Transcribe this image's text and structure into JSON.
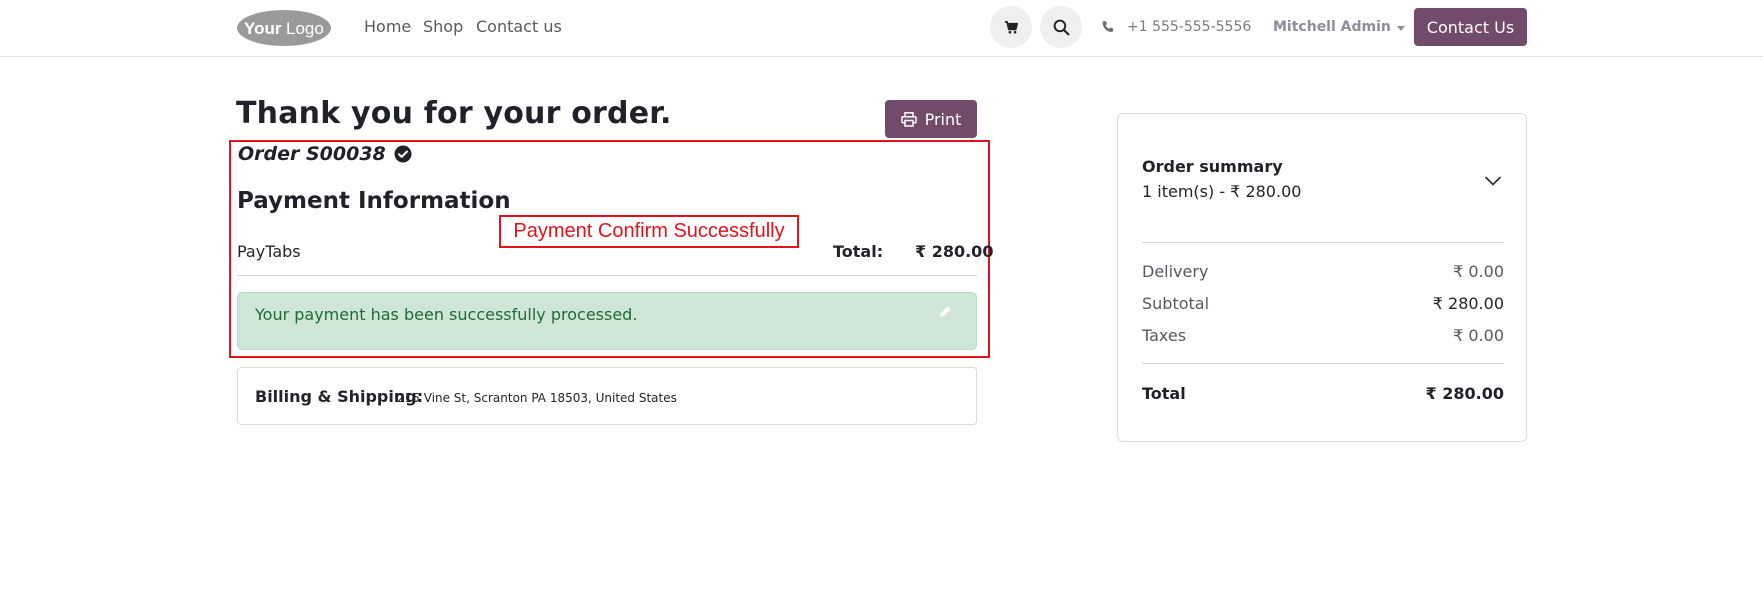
{
  "header": {
    "logo_text": "YourLogo",
    "nav": [
      "Home",
      "Shop",
      "Contact us"
    ],
    "phone": "+1 555-555-5556",
    "user": "Mitchell Admin",
    "contact_button": "Contact Us"
  },
  "main": {
    "title": "Thank you for your order.",
    "print_label": "Print",
    "order_label": "Order S00038",
    "payment_info_title": "Payment Information",
    "callout": "Payment Confirm Successfully",
    "provider": "PayTabs",
    "total_label": "Total:",
    "total_value": "₹ 280.00",
    "success_message": "Your payment has been successfully processed.",
    "billing_label": "Billing & Shipping:",
    "billing_address": "215 Vine St, Scranton PA 18503, United States"
  },
  "summary": {
    "title": "Order summary",
    "items_line": "1 item(s) -  ₹ 280.00",
    "rows": [
      {
        "label": "Delivery",
        "value": "₹ 0.00"
      },
      {
        "label": "Subtotal",
        "value": "₹ 280.00"
      },
      {
        "label": "Taxes",
        "value": "₹ 0.00"
      }
    ],
    "total_label": "Total",
    "total_value": "₹ 280.00"
  },
  "colors": {
    "brand": "#714b67",
    "annotation_red": "#e3131b",
    "success_bg": "#cfe6d6",
    "success_text": "#1e6b36"
  },
  "icons": [
    "cart-icon",
    "search-icon",
    "phone-icon",
    "print-icon",
    "check-circle-icon",
    "edit-pencil-icon",
    "chevron-down-icon"
  ]
}
